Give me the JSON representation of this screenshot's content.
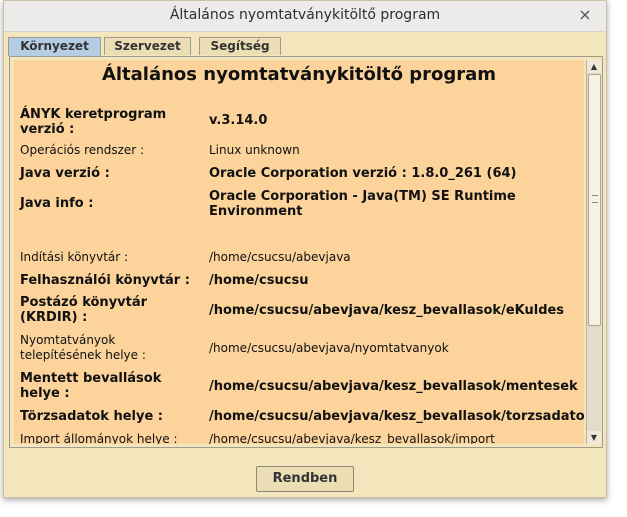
{
  "window": {
    "title": "Általános nyomtatványkitöltő program",
    "close_glyph": "×"
  },
  "tabs": [
    {
      "label": "Környezet",
      "active": true
    },
    {
      "label": "Szervezet",
      "active": false
    },
    {
      "label": "Segítség",
      "active": false
    }
  ],
  "content": {
    "heading": "Általános nyomtatványkitöltő program",
    "rows": [
      {
        "label": "ÁNYK keretprogram verzió :",
        "value": "v.3.14.0",
        "bold": true
      },
      {
        "label": "Operációs rendszer :",
        "value": "Linux unknown",
        "bold": false
      },
      {
        "label": "Java verzió :",
        "value": "Oracle Corporation verzió : 1.8.0_261 (64)",
        "bold": true
      },
      {
        "label": "Java info :",
        "value": "Oracle Corporation - Java(TM) SE Runtime Environment",
        "bold": true
      },
      {
        "label": "Indítási könyvtár :",
        "value": "/home/csucsu/abevjava",
        "bold": false
      },
      {
        "label": "Felhasználói könyvtár :",
        "value": "/home/csucsu",
        "bold": true
      },
      {
        "label": "Postázó könyvtár (KRDIR) :",
        "value": "/home/csucsu/abevjava/kesz_bevallasok/eKuldes",
        "bold": true
      },
      {
        "label": "Nyomtatványok telepítésének helye :",
        "value": "/home/csucsu/abevjava/nyomtatvanyok",
        "bold": false
      },
      {
        "label": "Mentett bevallások helye :",
        "value": "/home/csucsu/abevjava/kesz_bevallasok/mentesek",
        "bold": true
      },
      {
        "label": "Törzsadatok helye :",
        "value": "/home/csucsu/abevjava/kesz_bevallasok/torzsadatok",
        "bold": true
      },
      {
        "label": "Import állományok helye :",
        "value": "/home/csucsu/abevjava/kesz_bevallasok/import",
        "bold": false
      }
    ]
  },
  "scrollbar": {
    "up_glyph": "▲",
    "down_glyph": "▼"
  },
  "footer": {
    "ok_label": "Rendben"
  },
  "colors": {
    "content_bg": "#fbd39b",
    "window_bg": "#f3e6bd",
    "active_tab": "#b5cde3"
  }
}
